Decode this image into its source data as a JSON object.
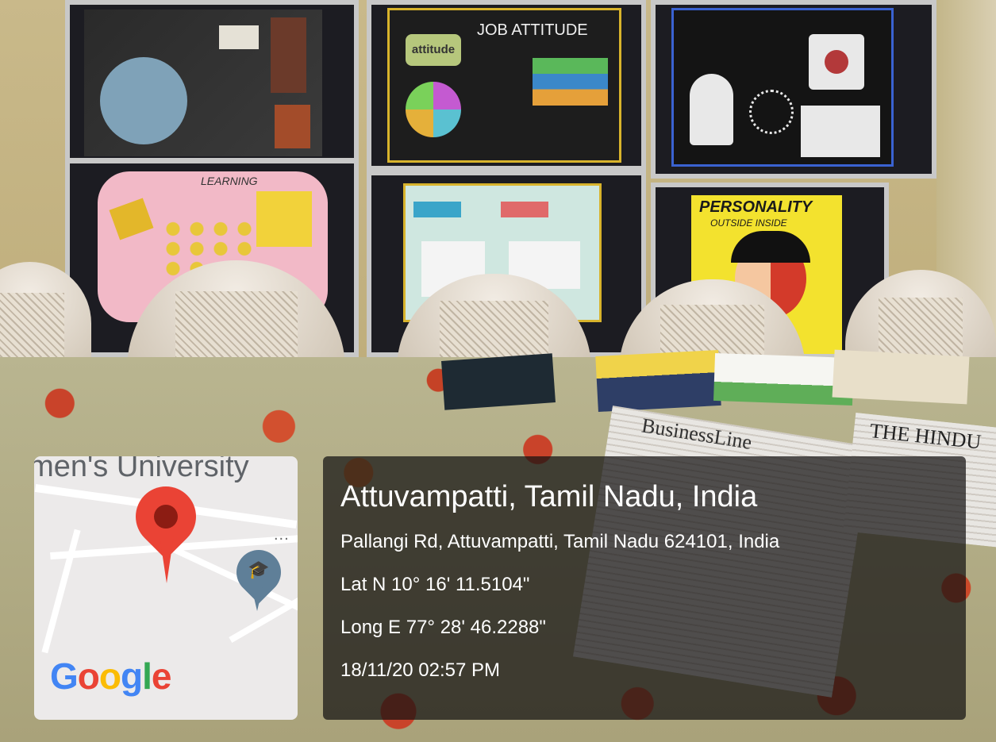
{
  "map": {
    "title": "omen's University",
    "logo": {
      "letters": [
        "G",
        "o",
        "o",
        "g",
        "l",
        "e"
      ],
      "colors": [
        "#4285F4",
        "#EA4335",
        "#FBBC05",
        "#4285F4",
        "#34A853",
        "#EA4335"
      ]
    },
    "more": "...",
    "pin_color": "#EA4335",
    "pin_icon": "location-pin-icon",
    "school_icon": "graduation-cap-icon"
  },
  "location": {
    "place": "Attuvampatti, Tamil Nadu, India",
    "address": "Pallangi Rd, Attuvampatti, Tamil Nadu 624101, India",
    "lat": "Lat N 10° 16' 11.5104\"",
    "long": "Long E 77° 28' 46.2288\"",
    "timestamp": "18/11/20 02:57 PM"
  },
  "posters": {
    "p2": "JOB ATTITUDE",
    "p2b": "attitude",
    "p4": "LEARNING",
    "p6a": "PERSONALITY",
    "p6b": "OUTSIDE   INSIDE"
  },
  "newspapers": {
    "n1": "BusinessLine",
    "n2": "THE HINDU"
  }
}
